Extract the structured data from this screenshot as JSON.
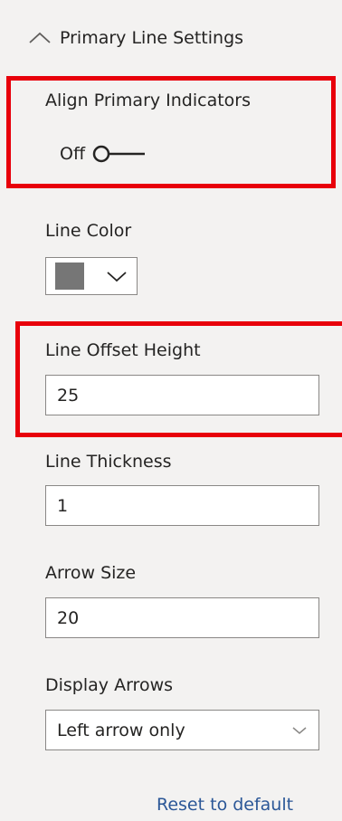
{
  "section": {
    "title": "Primary Line Settings"
  },
  "align_primary": {
    "label": "Align Primary Indicators",
    "state": "Off"
  },
  "line_color": {
    "label": "Line Color",
    "value": "#767676"
  },
  "line_offset": {
    "label": "Line Offset Height",
    "value": "25"
  },
  "line_thickness": {
    "label": "Line Thickness",
    "value": "1"
  },
  "arrow_size": {
    "label": "Arrow Size",
    "value": "20"
  },
  "display_arrows": {
    "label": "Display Arrows",
    "selected": "Left arrow only"
  },
  "reset": {
    "label": "Reset to default"
  },
  "colors": {
    "highlight": "#e8000b",
    "link": "#2b5797",
    "background": "#f3f2f1"
  }
}
